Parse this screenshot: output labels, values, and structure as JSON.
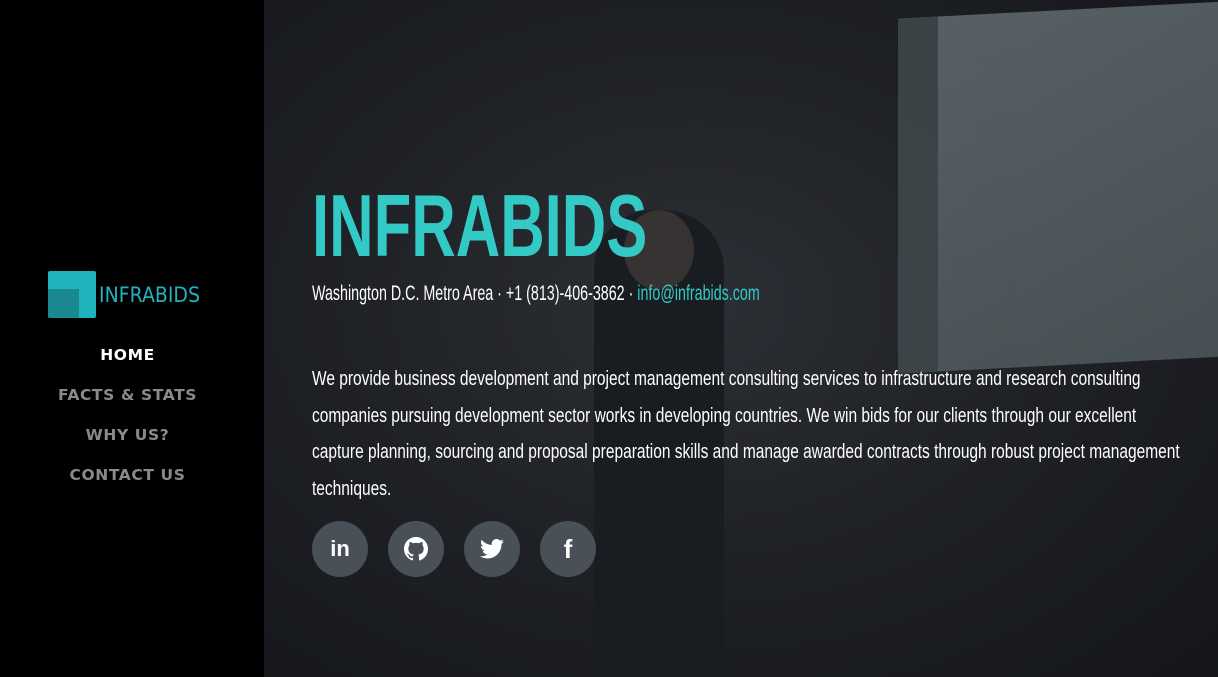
{
  "brand": {
    "name": "INFRABIDS",
    "color": "#22b2bd"
  },
  "nav": {
    "items": [
      {
        "label": "HOME",
        "active": true
      },
      {
        "label": "FACTS & STATS",
        "active": false
      },
      {
        "label": "WHY US?",
        "active": false
      },
      {
        "label": "CONTACT US",
        "active": false
      }
    ]
  },
  "hero": {
    "title": "INFRABIDS",
    "location": "Washington D.C. Metro Area",
    "separator": " · ",
    "phone": "+1 (813)-406-3862",
    "email": "info@infrabids.com",
    "description": "We provide business development and project management consulting services to infrastructure and research consulting companies pursuing development sector works in developing countries. We win bids for our clients through our excellent capture planning, sourcing and proposal preparation skills and manage awarded contracts through robust project management techniques.",
    "accent": "#33c9c5"
  },
  "social": [
    {
      "icon": "linkedin-icon",
      "glyph": "in"
    },
    {
      "icon": "github-icon",
      "glyph": "github"
    },
    {
      "icon": "twitter-icon",
      "glyph": "twitter"
    },
    {
      "icon": "facebook-icon",
      "glyph": "f"
    }
  ]
}
